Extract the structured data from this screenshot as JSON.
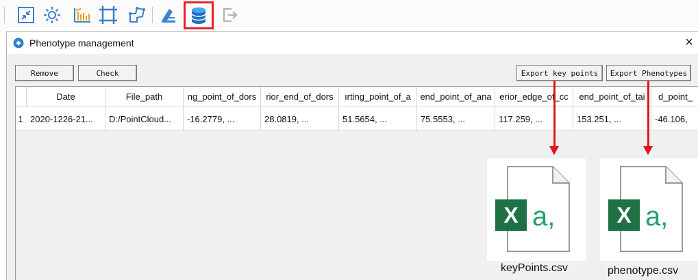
{
  "toolbar": {
    "buttons": [
      {
        "name": "collapse-icon"
      },
      {
        "name": "settings-icon"
      },
      {
        "name": "chart-icon"
      },
      {
        "name": "crop-icon"
      },
      {
        "name": "skeleton-icon"
      },
      {
        "name": "annotate-icon"
      },
      {
        "name": "database-icon",
        "highlighted": true
      },
      {
        "name": "exit-icon"
      }
    ],
    "highlight_color": "#e8202a"
  },
  "dialog": {
    "title": "Phenotype management",
    "close_symbol": "×",
    "buttons": {
      "remove": "Remove",
      "check": "Check",
      "export_key_points": "Export key points",
      "export_phenotypes": "Export Phenotypes"
    },
    "table": {
      "columns": [
        "Date",
        "File_path",
        "ng_point_of_dors",
        "rior_end_of_dors",
        "ırting_point_of_a",
        "end_point_of_ana",
        "erior_edge_of_cc",
        "end_point_of_tai",
        "d_point_"
      ],
      "rows": [
        {
          "index": "1",
          "cells": [
            "2020-1226-21...",
            "D:/PointCloud...",
            "-16.2779, ...",
            "28.0819, ...",
            "51.5654, ...",
            "75.5553, ...",
            "117.259, ...",
            "153.251, ...",
            "-46.106,"
          ]
        }
      ]
    }
  },
  "files": [
    {
      "name": "keyPoints.csv",
      "icon": "excel-csv-icon"
    },
    {
      "name": "phenotype.csv",
      "icon": "excel-csv-icon"
    }
  ],
  "colors": {
    "arrow": "#e0151e",
    "excel_green": "#1e7145",
    "excel_light_green": "#21a366"
  }
}
